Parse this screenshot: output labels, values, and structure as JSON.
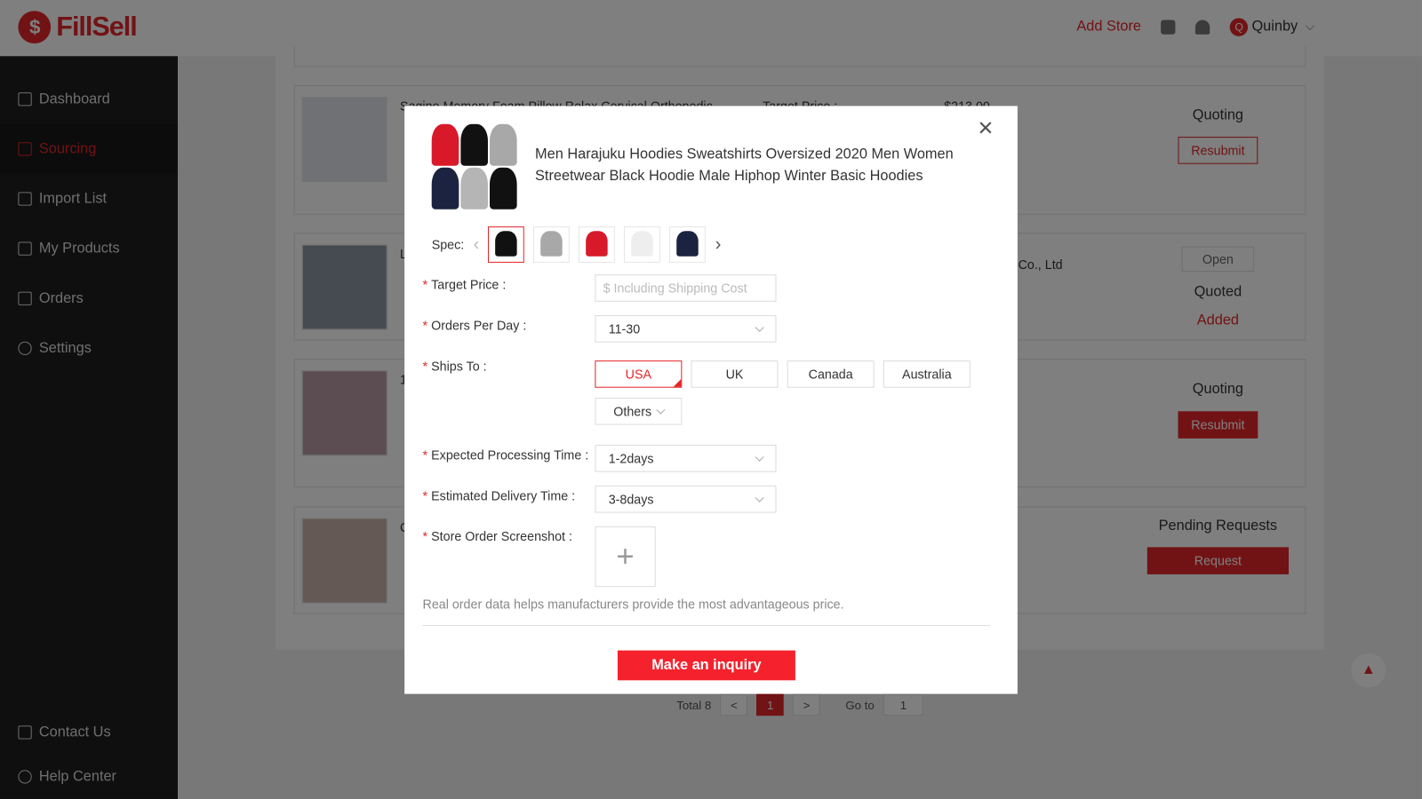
{
  "header": {
    "brand": "FillSell",
    "add_store": "Add Store",
    "user_initial": "Q",
    "user_name": "Quinby"
  },
  "sidebar": {
    "items": [
      {
        "label": "Dashboard",
        "icon": "chart-icon"
      },
      {
        "label": "Sourcing",
        "icon": "cart-icon",
        "active": true
      },
      {
        "label": "Import List",
        "icon": "import-icon"
      },
      {
        "label": "My Products",
        "icon": "box-icon"
      },
      {
        "label": "Orders",
        "icon": "list-icon"
      },
      {
        "label": "Settings",
        "icon": "gear-icon"
      }
    ],
    "bottom": [
      {
        "label": "Contact Us",
        "icon": "message-icon"
      },
      {
        "label": "Help Center",
        "icon": "help-icon"
      }
    ]
  },
  "background_cards": [
    {
      "title": "Sagino Memory Foam Pillow Relax Cervical Orthopedic",
      "target_price_label": "Target Price :",
      "price": "$213.00",
      "status": "Quoting",
      "button": "Resubmit"
    },
    {
      "title": "L",
      "supplier": "g Co., Ltd",
      "open": "Open",
      "status": "Quoted",
      "status2": "Added"
    },
    {
      "title": "1",
      "status": "Quoting",
      "button": "Resubmit"
    },
    {
      "title": "C",
      "status": "Pending Requests",
      "button": "Request"
    }
  ],
  "pagination": {
    "total": "Total 8",
    "current": "1",
    "goto_label": "Go to",
    "goto_value": "1",
    "prev": "<",
    "next": ">"
  },
  "modal": {
    "product_title": "Men Harajuku Hoodies Sweatshirts Oversized 2020 Men Women Streetwear Black Hoodie Male Hiphop Winter Basic Hoodies",
    "spec_label": "Spec:",
    "spec_colors": [
      "#111111",
      "#a8a8a8",
      "#d8192a",
      "#eeeeee",
      "#1b2340"
    ],
    "target_price_label": "Target Price :",
    "target_price_placeholder": "$ Including Shipping Cost",
    "orders_per_day_label": "Orders Per Day :",
    "orders_per_day_value": "11-30",
    "ships_to_label": "Ships To :",
    "ships_to_options": [
      "USA",
      "UK",
      "Canada",
      "Australia"
    ],
    "ships_to_selected": "USA",
    "others_label": "Others",
    "processing_label": "Expected Processing Time :",
    "processing_value": "1-2days",
    "delivery_label": "Estimated Delivery Time :",
    "delivery_value": "3-8days",
    "screenshot_label": "Store Order Screenshot :",
    "hint": "Real order data helps manufacturers provide the most advantageous price.",
    "submit": "Make an inquiry",
    "required_mark": "*"
  },
  "colors": {
    "accent": "#e3262b",
    "submit": "#f5222d"
  }
}
